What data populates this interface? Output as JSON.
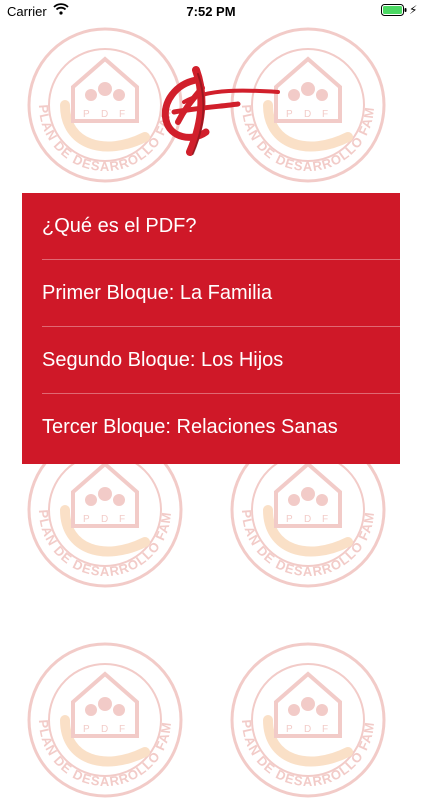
{
  "status_bar": {
    "carrier": "Carrier",
    "time": "7:52 PM",
    "wifi_icon": "wifi-icon",
    "battery_icon": "battery-icon",
    "charging_icon": "bolt-icon"
  },
  "watermark": {
    "caption": "PLAN DE DESARROLLO FAMILIAR",
    "house_letters": [
      "P",
      "D",
      "F"
    ],
    "color": "#e8a29c",
    "accent_color": "#f6c79a"
  },
  "logo": {
    "icon": "pdf-stylized-monogram-icon",
    "color": "#d11f2b"
  },
  "menu": {
    "background": "#cf1828",
    "items": [
      {
        "label": "¿Qué es el PDF?"
      },
      {
        "label": "Primer Bloque: La Familia"
      },
      {
        "label": "Segundo Bloque: Los Hijos"
      },
      {
        "label": "Tercer Bloque: Relaciones Sanas"
      }
    ]
  }
}
